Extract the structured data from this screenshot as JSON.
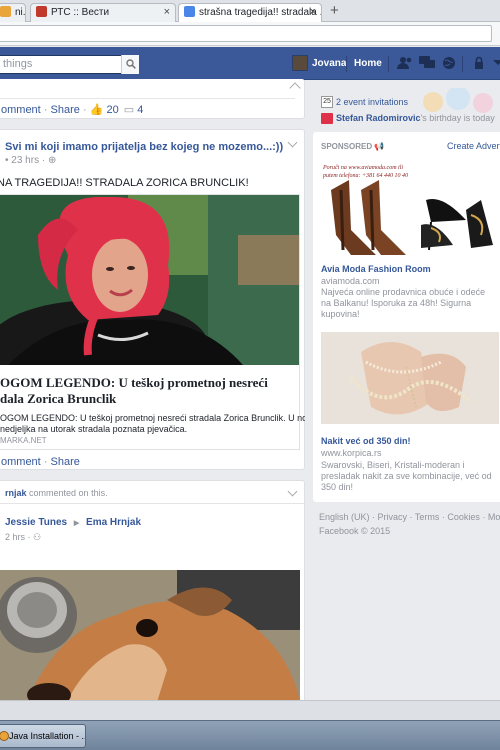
{
  "browser": {
    "tabs": [
      {
        "label": "ni...",
        "favicon_color": "#e9a53a"
      },
      {
        "label": "РТС :: Вести",
        "favicon_color": "#c0392b"
      },
      {
        "label": "strašna tragedija!! stradala ...",
        "favicon_color": "#4a86e8"
      }
    ],
    "close_glyph": "×",
    "new_tab_glyph": "+"
  },
  "fbbar": {
    "search_placeholder": "things",
    "user_name": "Jovana",
    "home_label": "Home"
  },
  "feed": {
    "top_actions": {
      "comment": "omment",
      "share": "Share",
      "likes": "20",
      "comments": "4"
    },
    "post1": {
      "header": "Svi mi koji imamo prijatelja bez kojeg ne mozemo...:))",
      "time": "23 hrs",
      "text": "NA TRAGEDIJA!! STRADALA ZORICA BRUNCLIK!",
      "link_title_line1": "OGOM LEGENDO: U teškoj prometnoj nesreći",
      "link_title_line2": "dala Zorica Brunclik",
      "link_desc_line1": "OGOM LEGENDO: U teškoj prometnoj nesreći stradala Zorica Brunclik. U noći",
      "link_desc_line2": "nedjeljka na utorak stradala poznata pjevačica.",
      "link_domain": "MARKA.NET",
      "actions": {
        "comment": "omment",
        "share": "Share"
      }
    },
    "post2": {
      "commented_name": "rnjak",
      "commented_text": "commented on this.",
      "author": "Jessie Tunes",
      "arrow": "▶",
      "target": "Ema Hrnjak",
      "time": "2 hrs"
    }
  },
  "rightcol": {
    "events": {
      "day": "25",
      "label": "2 event invitations"
    },
    "birthday": {
      "name": "Stefan Radomirovic",
      "text": "'s birthday is today"
    },
    "sponsored_label": "SPONSORED",
    "create_advert": "Create Advert",
    "ad1": {
      "banner_text_line1": "Poruči na www.aviamoda.com ili",
      "banner_text_line2": "putem telefona: +381 64 440 10 40",
      "title": "Avia Moda Fashion Room",
      "domain": "aviamoda.com",
      "desc": "Najveća online prodavnica obuće i odeće na Balkanu! Isporuka za 48h! Sigurna kupovina!"
    },
    "ad2": {
      "title": "Nakit već od 350 din!",
      "domain": "www.korpica.rs",
      "desc": "Swarovski, Biseri, Kristali-moderan i presladak nakit za sve kombinacije, već od 350 din!"
    },
    "footer": {
      "links": [
        "English (UK)",
        "Privacy",
        "Terms",
        "Cookies",
        "More"
      ],
      "copyright": "Facebook © 2015"
    }
  },
  "taskbar": {
    "app_label": "Java Installation - ..."
  },
  "colors": {
    "fb_blue": "#3b5998",
    "link": "#365899",
    "muted": "#90949c"
  }
}
